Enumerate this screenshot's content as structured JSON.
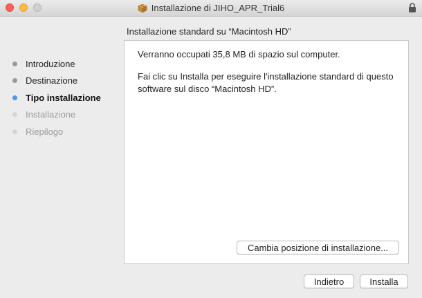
{
  "window": {
    "title": "Installazione di JIHO_APR_Trial6",
    "title_icon": "package-icon",
    "lock_icon": "lock-icon"
  },
  "header": {
    "subtitle": "Installazione standard su “Macintosh HD”"
  },
  "sidebar": {
    "steps": [
      {
        "label": "Introduzione",
        "state": "done"
      },
      {
        "label": "Destinazione",
        "state": "done"
      },
      {
        "label": "Tipo installazione",
        "state": "current"
      },
      {
        "label": "Installazione",
        "state": "pending"
      },
      {
        "label": "Riepilogo",
        "state": "pending"
      }
    ]
  },
  "content": {
    "space_text": "Verranno occupati 35,8 MB di spazio sul computer.",
    "instruction_text": "Fai clic su Installa per eseguire l'installazione standard di questo software sul disco “Macintosh HD”.",
    "change_location_label": "Cambia posizione di installazione..."
  },
  "footer": {
    "back_label": "Indietro",
    "install_label": "Installa"
  },
  "colors": {
    "current_step_dot": "#4a9bf0",
    "done_step_dot": "#9a9a9a",
    "pending_step_dot": "#d4d4d4",
    "close_button": "#fc605c",
    "minimize_button": "#fdbc40"
  }
}
